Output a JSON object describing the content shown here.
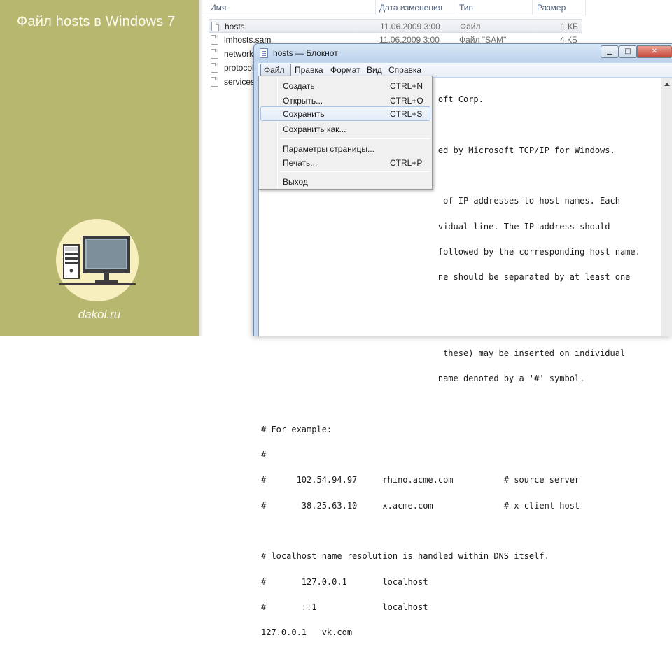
{
  "banner": {
    "title": "Файл hosts в Windows 7",
    "site": "dakol.ru"
  },
  "explorer": {
    "columns": [
      "Имя",
      "Дата изменения",
      "Тип",
      "Размер"
    ],
    "files": [
      {
        "name": "hosts",
        "date": "11.06.2009 3:00",
        "type": "Файл",
        "size": "1 КБ"
      },
      {
        "name": "lmhosts.sam",
        "date": "11.06.2009 3:00",
        "type": "Файл \"SAM\"",
        "size": "4 КБ"
      },
      {
        "name": "networks",
        "date": "",
        "type": "",
        "size": ""
      },
      {
        "name": "protocol",
        "date": "",
        "type": "",
        "size": ""
      },
      {
        "name": "services",
        "date": "",
        "type": "",
        "size": ""
      }
    ]
  },
  "notepad": {
    "title": "hosts — Блокнот",
    "controls": {
      "minimize": "▁",
      "maximize": "□",
      "close": "✕"
    },
    "menu": [
      "Файл",
      "Правка",
      "Формат",
      "Вид",
      "Справка"
    ],
    "file_menu": {
      "items": [
        {
          "label": "Создать",
          "shortcut": "CTRL+N"
        },
        {
          "label": "Открыть...",
          "shortcut": "CTRL+O"
        },
        {
          "label": "Сохранить",
          "shortcut": "CTRL+S"
        },
        {
          "label": "Сохранить как...",
          "shortcut": ""
        },
        {
          "label": "Параметры страницы...",
          "shortcut": ""
        },
        {
          "label": "Печать...",
          "shortcut": "CTRL+P"
        },
        {
          "label": "Выход",
          "shortcut": ""
        }
      ]
    },
    "text_lines": [
      "                                   oft Corp.",
      "",
      "                                   ed by Microsoft TCP/IP for Windows.",
      "",
      "                                    of IP addresses to host names. Each",
      "                                   vidual line. The IP address should",
      "                                   followed by the corresponding host name.",
      "                                   ne should be separated by at least one",
      "",
      "",
      "                                    these) may be inserted on individual",
      "                                   name denoted by a '#' symbol.",
      "",
      "# For example:",
      "#",
      "#      102.54.94.97     rhino.acme.com          # source server",
      "#       38.25.63.10     x.acme.com              # x client host",
      "",
      "# localhost name resolution is handled within DNS itself.",
      "#       127.0.0.1       localhost",
      "#       ::1             localhost",
      "127.0.0.1   vk.com"
    ]
  },
  "colors": {
    "banner_bg": "#b7b76f",
    "logo_circle": "#f8efbf",
    "window_frame": "#c4d7ee"
  }
}
